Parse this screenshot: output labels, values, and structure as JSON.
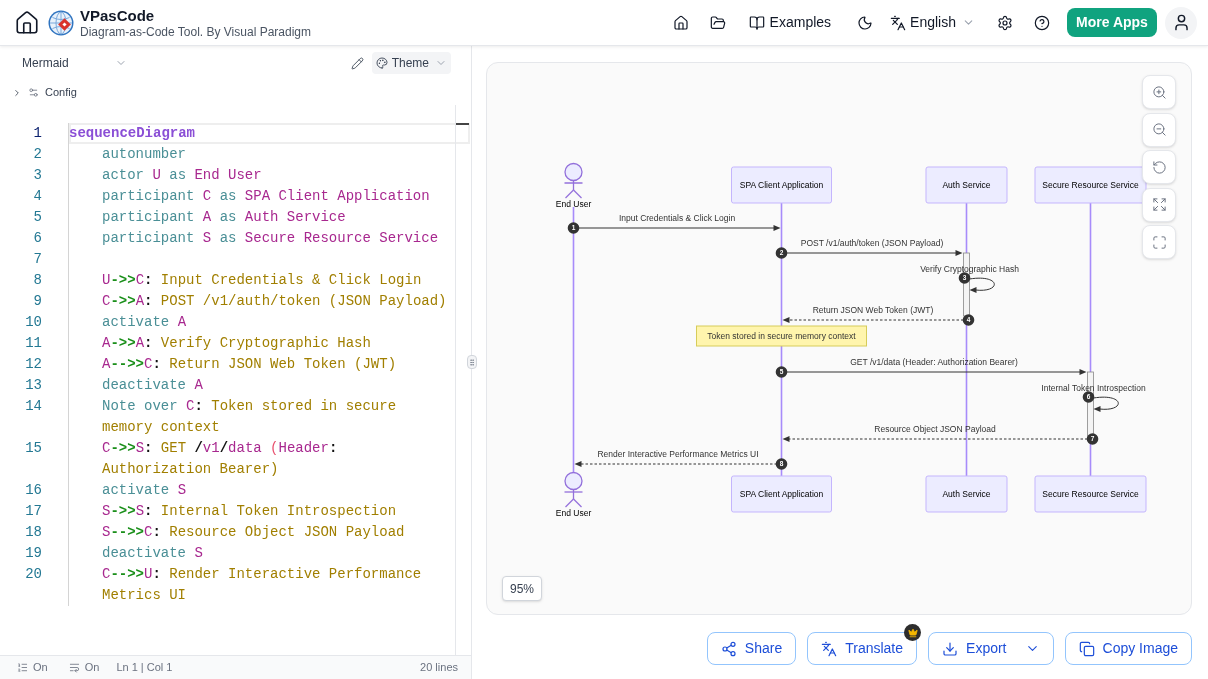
{
  "header": {
    "title": "VPasCode",
    "subtitle": "Diagram-as-Code Tool. By Visual Paradigm",
    "examples": "Examples",
    "language": "English",
    "more_apps": "More Apps"
  },
  "editor": {
    "diagram_type": "Mermaid",
    "theme": "Theme",
    "config": "Config",
    "lines": [
      {
        "number": "1",
        "current": true,
        "indented": false,
        "tokens": [
          {
            "kind": "title",
            "text": "sequenceDiagram"
          }
        ]
      },
      {
        "number": "2",
        "current": false,
        "indented": true,
        "tokens": [
          {
            "kind": "keyword",
            "text": "autonumber"
          }
        ]
      },
      {
        "number": "3",
        "current": false,
        "indented": true,
        "tokens": [
          {
            "kind": "keyword",
            "text": "actor "
          },
          {
            "kind": "name",
            "text": "U"
          },
          {
            "kind": "keyword",
            "text": " as "
          },
          {
            "kind": "name",
            "text": "End User"
          }
        ]
      },
      {
        "number": "4",
        "current": false,
        "indented": true,
        "tokens": [
          {
            "kind": "keyword",
            "text": "participant "
          },
          {
            "kind": "name",
            "text": "C"
          },
          {
            "kind": "keyword",
            "text": " as "
          },
          {
            "kind": "name",
            "text": "SPA Client Application"
          }
        ]
      },
      {
        "number": "5",
        "current": false,
        "indented": true,
        "tokens": [
          {
            "kind": "keyword",
            "text": "participant "
          },
          {
            "kind": "name",
            "text": "A"
          },
          {
            "kind": "keyword",
            "text": " as "
          },
          {
            "kind": "name",
            "text": "Auth Service"
          }
        ]
      },
      {
        "number": "6",
        "current": false,
        "indented": true,
        "tokens": [
          {
            "kind": "keyword",
            "text": "participant "
          },
          {
            "kind": "name",
            "text": "S"
          },
          {
            "kind": "keyword",
            "text": " as "
          },
          {
            "kind": "name",
            "text": "Secure Resource Service"
          }
        ]
      },
      {
        "number": "7",
        "current": false
      },
      {
        "number": "8",
        "current": false,
        "indented": true,
        "tokens": [
          {
            "kind": "name",
            "text": "U"
          },
          {
            "kind": "arrow",
            "text": "->>"
          },
          {
            "kind": "name",
            "text": "C"
          },
          {
            "kind": "punct",
            "text": ":"
          },
          {
            "kind": "text",
            "text": " Input Credentials & Click Login"
          }
        ]
      },
      {
        "number": "9",
        "current": false,
        "indented": true,
        "tokens": [
          {
            "kind": "name",
            "text": "C"
          },
          {
            "kind": "arrow",
            "text": "->>"
          },
          {
            "kind": "name",
            "text": "A"
          },
          {
            "kind": "punct",
            "text": ":"
          },
          {
            "kind": "text",
            "text": " POST /v1/auth/token (JSON Payload)"
          }
        ]
      },
      {
        "number": "10",
        "current": false,
        "indented": true,
        "tokens": [
          {
            "kind": "keyword",
            "text": "activate "
          },
          {
            "kind": "name",
            "text": "A"
          }
        ]
      },
      {
        "number": "11",
        "current": false,
        "indented": true,
        "tokens": [
          {
            "kind": "name",
            "text": "A"
          },
          {
            "kind": "arrow",
            "text": "->>"
          },
          {
            "kind": "name",
            "text": "A"
          },
          {
            "kind": "punct",
            "text": ":"
          },
          {
            "kind": "text",
            "text": " Verify Cryptographic Hash"
          }
        ]
      },
      {
        "number": "12",
        "current": false,
        "indented": true,
        "tokens": [
          {
            "kind": "name",
            "text": "A"
          },
          {
            "kind": "arrow",
            "text": "-->>"
          },
          {
            "kind": "name",
            "text": "C"
          },
          {
            "kind": "punct",
            "text": ":"
          },
          {
            "kind": "text",
            "text": " Return JSON Web Token (JWT)"
          }
        ]
      },
      {
        "number": "13",
        "current": false,
        "indented": true,
        "tokens": [
          {
            "kind": "keyword",
            "text": "deactivate "
          },
          {
            "kind": "name",
            "text": "A"
          }
        ]
      },
      {
        "number": "14",
        "current": false,
        "indented": true,
        "tokens": [
          {
            "kind": "keyword",
            "text": "Note over "
          },
          {
            "kind": "name",
            "text": "C"
          },
          {
            "kind": "punct",
            "text": ":"
          },
          {
            "kind": "text",
            "text": " Token stored in secure memory context"
          }
        ]
      },
      {
        "number": "15",
        "current": false,
        "indented": true,
        "tokens": [
          {
            "kind": "name",
            "text": "C"
          },
          {
            "kind": "arrow",
            "text": "->>"
          },
          {
            "kind": "name",
            "text": "S"
          },
          {
            "kind": "punct",
            "text": ":"
          },
          {
            "kind": "text",
            "text": " GET "
          },
          {
            "kind": "punct",
            "text": "/"
          },
          {
            "kind": "name",
            "text": "v1"
          },
          {
            "kind": "punct",
            "text": "/"
          },
          {
            "kind": "name",
            "text": "data"
          },
          {
            "kind": "paren",
            "text": " ("
          },
          {
            "kind": "name",
            "text": "Header"
          },
          {
            "kind": "punct",
            "text": ":"
          },
          {
            "kind": "text",
            "text": " Authorization Bearer)"
          }
        ]
      },
      {
        "number": "16",
        "current": false,
        "indented": true,
        "tokens": [
          {
            "kind": "keyword",
            "text": "activate "
          },
          {
            "kind": "name",
            "text": "S"
          }
        ]
      },
      {
        "number": "17",
        "current": false,
        "indented": true,
        "tokens": [
          {
            "kind": "name",
            "text": "S"
          },
          {
            "kind": "arrow",
            "text": "->>"
          },
          {
            "kind": "name",
            "text": "S"
          },
          {
            "kind": "punct",
            "text": ":"
          },
          {
            "kind": "text",
            "text": " Internal Token Introspection"
          }
        ]
      },
      {
        "number": "18",
        "current": false,
        "indented": true,
        "tokens": [
          {
            "kind": "name",
            "text": "S"
          },
          {
            "kind": "arrow",
            "text": "-->>"
          },
          {
            "kind": "name",
            "text": "C"
          },
          {
            "kind": "punct",
            "text": ":"
          },
          {
            "kind": "text",
            "text": " Resource Object JSON Payload"
          }
        ]
      },
      {
        "number": "19",
        "current": false,
        "indented": true,
        "tokens": [
          {
            "kind": "keyword",
            "text": "deactivate "
          },
          {
            "kind": "name",
            "text": "S"
          }
        ]
      },
      {
        "number": "20",
        "current": false,
        "indented": true,
        "tokens": [
          {
            "kind": "name",
            "text": "C"
          },
          {
            "kind": "arrow",
            "text": "-->>"
          },
          {
            "kind": "name",
            "text": "U"
          },
          {
            "kind": "punct",
            "text": ":"
          },
          {
            "kind": "text",
            "text": " Render Interactive Performance Metrics UI"
          }
        ]
      }
    ],
    "status_bar": {
      "line_numbers": "On",
      "word_wrap": "On",
      "cursor": "Ln 1 | Col 1",
      "line_count": "20 lines"
    }
  },
  "preview": {
    "diagram": {
      "participants": [
        {
          "kind": "actor",
          "top_label": "End User",
          "bottom_label": "End User"
        },
        {
          "kind": "box",
          "top_label": "SPA Client Application",
          "bottom_label": "SPA Client Application"
        },
        {
          "kind": "box",
          "top_label": "Auth Service",
          "bottom_label": "Auth Service"
        },
        {
          "kind": "box",
          "top_label": "Secure Resource Service",
          "bottom_label": "Secure Resource Service"
        }
      ],
      "messages": [
        {
          "number": "1",
          "kind": "sync",
          "label": "Input Credentials & Click Login"
        },
        {
          "number": "2",
          "kind": "sync",
          "label": "POST /v1/auth/token (JSON Payload)"
        },
        {
          "number": "3",
          "kind": "self",
          "label": "Verify Cryptographic Hash"
        },
        {
          "number": "4",
          "kind": "reply",
          "label": "Return JSON Web Token (JWT)"
        },
        {
          "number": "5",
          "kind": "sync",
          "label": "GET /v1/data (Header: Authorization Bearer)"
        },
        {
          "number": "6",
          "kind": "self",
          "label": "Internal Token Introspection"
        },
        {
          "number": "7",
          "kind": "reply",
          "label": "Resource Object JSON Payload"
        },
        {
          "number": "8",
          "kind": "reply",
          "label": "Render Interactive Performance Metrics UI"
        }
      ],
      "note": {
        "text": "Token stored in secure memory context"
      }
    },
    "zoom": "95%"
  },
  "actions": [
    {
      "kind": "share",
      "label": "Share",
      "premium": false,
      "menu": false
    },
    {
      "kind": "translate",
      "label": "Translate",
      "premium": true,
      "menu": false
    },
    {
      "kind": "export",
      "label": "Export",
      "premium": false,
      "menu": true
    },
    {
      "kind": "copy",
      "label": "Copy Image",
      "premium": false,
      "menu": false
    }
  ]
}
